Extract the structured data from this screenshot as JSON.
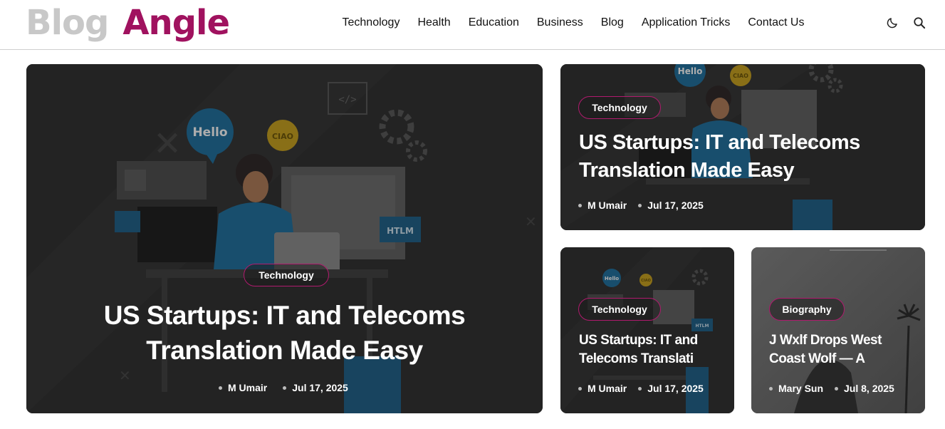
{
  "logo": {
    "word1": "Blog",
    "word2": "Angle"
  },
  "nav": [
    "Technology",
    "Health",
    "Education",
    "Business",
    "Blog",
    "Application Tricks",
    "Contact Us"
  ],
  "colors": {
    "brand": "#a0125f",
    "badge_border": "#b11a6e",
    "card_bg": "#2c2c2c"
  },
  "icons": {
    "theme_toggle": "moon-icon",
    "search": "search-icon"
  },
  "cards": [
    {
      "badge": "Technology",
      "title": "US Startups: IT and Telecoms Translation Made Easy",
      "author": "M Umair",
      "date": "Jul 17, 2025",
      "art": {
        "hello": "Hello",
        "ciao": "CIAO",
        "html": "HTLM",
        "code": "</>"
      }
    },
    {
      "badge": "Technology",
      "title": "US Startups: IT and Telecoms Translation Made Easy",
      "author": "M Umair",
      "date": "Jul 17, 2025",
      "art": {
        "hello": "Hello",
        "ciao": "CIAO"
      }
    },
    {
      "badge": "Technology",
      "title": "US Startups: IT and Telecoms Translati",
      "author": "M Umair",
      "date": "Jul 17, 2025",
      "art": {
        "hello": "Hello",
        "ciao": "CIAO",
        "html": "HTLM"
      }
    },
    {
      "badge": "Biography",
      "title": "J Wxlf Drops West Coast Wolf — A",
      "author": "Mary Sun",
      "date": "Jul 8, 2025"
    }
  ]
}
